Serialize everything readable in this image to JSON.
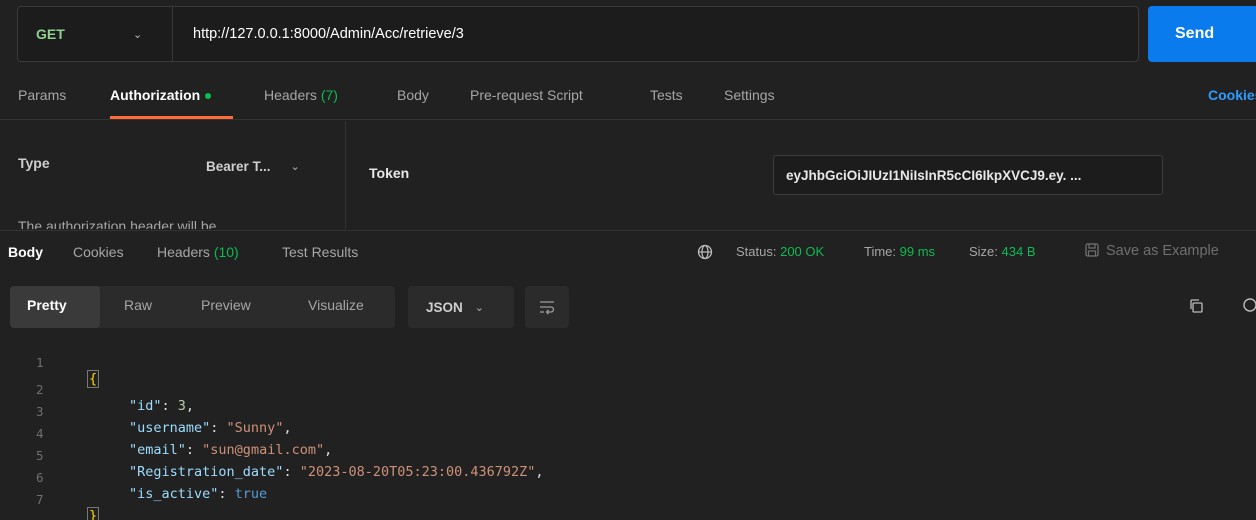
{
  "request": {
    "method": "GET",
    "url": "http://127.0.0.1:8000/Admin/Acc/retrieve/3",
    "send_label": "Send"
  },
  "request_tabs": {
    "params": "Params",
    "authorization": "Authorization",
    "headers": "Headers",
    "headers_count": "(7)",
    "body": "Body",
    "prerequest": "Pre-request Script",
    "tests": "Tests",
    "settings": "Settings",
    "cookies": "Cookies"
  },
  "auth": {
    "type_label": "Type",
    "type_value": "Bearer T...",
    "description": "The authorization header will be",
    "token_label": "Token",
    "token_value": "eyJhbGciOiJIUzI1NiIsInR5cCI6IkpXVCJ9.ey. ..."
  },
  "response_tabs": {
    "body": "Body",
    "cookies": "Cookies",
    "headers": "Headers",
    "headers_count": "(10)",
    "test_results": "Test Results"
  },
  "response_meta": {
    "status_label": "Status:",
    "status_value": "200 OK",
    "time_label": "Time:",
    "time_value": "99 ms",
    "size_label": "Size:",
    "size_value": "434 B",
    "save_example": "Save as Example"
  },
  "toolbar": {
    "pretty": "Pretty",
    "raw": "Raw",
    "preview": "Preview",
    "visualize": "Visualize",
    "format": "JSON"
  },
  "response_body": {
    "line_numbers": [
      "1",
      "2",
      "3",
      "4",
      "5",
      "6",
      "7"
    ],
    "open_brace": "{",
    "close_brace": "}",
    "fields": [
      {
        "key": "\"id\"",
        "value": "3",
        "suffix": ","
      },
      {
        "key": "\"username\"",
        "value": "\"Sunny\"",
        "suffix": ","
      },
      {
        "key": "\"email\"",
        "value": "\"sun@gmail.com\"",
        "suffix": ","
      },
      {
        "key": "\"Registration_date\"",
        "value": "\"2023-08-20T05:23:00.436792Z\"",
        "suffix": ","
      },
      {
        "key": "\"is_active\"",
        "value": "true",
        "suffix": ""
      }
    ]
  }
}
